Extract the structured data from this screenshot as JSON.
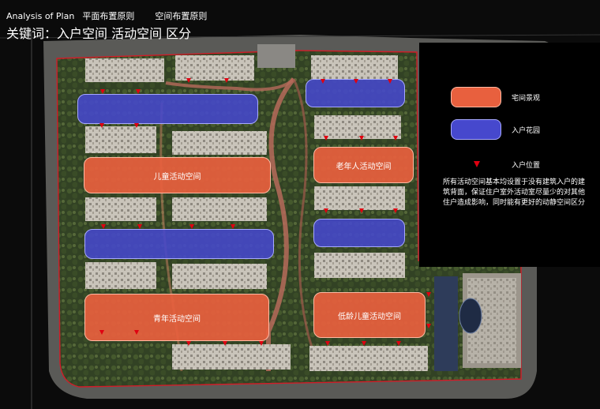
{
  "header": {
    "title_en": "Analysis of Plan",
    "title_cn_1": "平面布置原则",
    "title_cn_2": "空间布置原则",
    "subtitle": "关键词：入户空间 活动空间 区分"
  },
  "zones": {
    "children_activity": "儿童活动空间",
    "elderly_activity": "老年人活动空间",
    "youth_activity": "青年活动空间",
    "toddler_activity": "低龄儿童活动空间"
  },
  "legend": {
    "landscape_label": "宅间景观",
    "entry_garden_label": "入户花园",
    "entry_position_label": "入户位置",
    "description": "所有活动空间基本均设置于没有建筑入户的建筑背面，保证住户室外活动室尽量少的对其他住户造成影响，同时能有更好的动静空间区分"
  },
  "colors": {
    "landscape": "#e8603e",
    "entry_garden": "#4648cd",
    "entry_marker": "#e00010",
    "site_boundary": "#d21c28"
  }
}
